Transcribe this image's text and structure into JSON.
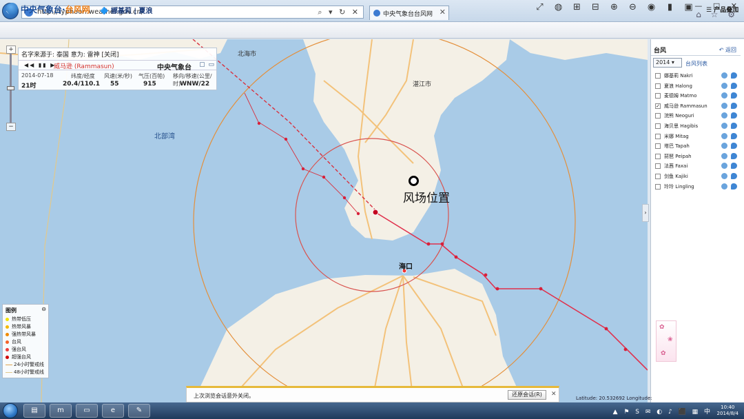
{
  "browser": {
    "url": "http://typhoon.weather.gov.cn/",
    "tab_title": "中央气象台台风网",
    "back_icon": "back-arrow-icon",
    "window_controls": [
      "—",
      "□",
      "✕"
    ],
    "toolbar_icons": [
      "home-icon",
      "star-icon",
      "gear-icon"
    ]
  },
  "app": {
    "site_title_main": "中央气象台·",
    "site_title_accent": "台风网",
    "active_typhoons": "娜基莉 | 夏浪",
    "product_overlay": "产品叠加",
    "tools": [
      "fullscreen-icon",
      "globe-icon",
      "zoom-box-in-icon",
      "zoom-box-out-icon",
      "zoom-in-icon",
      "zoom-out-icon",
      "layers-icon",
      "document-icon",
      "camera-icon"
    ]
  },
  "info_panel": {
    "source_line": "名字来源于: 泰国  意为: 雷神   [关闭]",
    "play_controls": "◀◀ ▮▮ ▶",
    "typhoon_name": "威马逊 (Rammasun)",
    "agency": "中央气象台",
    "headers": [
      "2014-07-18",
      "纬度/经度",
      "风速(米/秒)",
      "气压(百帕)",
      "移向/移速(公里/时)"
    ],
    "time_label": "21时",
    "values": [
      "20.4/110.1",
      "55",
      "915",
      "WNW/22"
    ]
  },
  "map": {
    "gulf_label": "北部湾",
    "haikou_label": "海口",
    "zhanjiang_label": "湛江市",
    "beihai_label": "北海市",
    "wind_field_label": "风场位置"
  },
  "legend": {
    "title": "图例",
    "close": "⊖",
    "items": [
      {
        "label": "热带低压",
        "color": "#f3e200"
      },
      {
        "label": "热带风暴",
        "color": "#f5b800"
      },
      {
        "label": "强热带风暴",
        "color": "#f08a00"
      },
      {
        "label": "台风",
        "color": "#f5632a"
      },
      {
        "label": "强台风",
        "color": "#ee3e3e"
      },
      {
        "label": "超强台风",
        "color": "#cf0000"
      }
    ],
    "lines": [
      {
        "label": "24小时警戒线",
        "color": "#e0a450"
      },
      {
        "label": "48小时警戒线",
        "color": "#e0c88a"
      }
    ]
  },
  "sidebar": {
    "title": "台风",
    "back": "返回",
    "year": "2014 ▾",
    "list_title": "台风列表",
    "typhoons": [
      {
        "name": "娜基莉 Nakri",
        "checked": false
      },
      {
        "name": "夏浪 Halong",
        "checked": false
      },
      {
        "name": "麦德姆 Matmo",
        "checked": false
      },
      {
        "name": "威马逊 Rammasun",
        "checked": true
      },
      {
        "name": "浣熊 Neoguri",
        "checked": false
      },
      {
        "name": "海贝思 Hagibis",
        "checked": false
      },
      {
        "name": "米娜 Mitag",
        "checked": false
      },
      {
        "name": "塔巴 Tapah",
        "checked": false
      },
      {
        "name": "琵琶 Peipah",
        "checked": false
      },
      {
        "name": "法茜 Faxai",
        "checked": false
      },
      {
        "name": "剑鱼 Kajiki",
        "checked": false
      },
      {
        "name": "玲玲 Lingling",
        "checked": false
      }
    ]
  },
  "notification": {
    "text": "上次浏览会话意外关闭。",
    "button": "还原会话(R)",
    "close": "✕"
  },
  "status": {
    "latitude": "Latitude: 20.532692   Longitude:"
  },
  "taskbar": {
    "apps": [
      "▤",
      "m",
      "▭",
      "e",
      "✎"
    ],
    "tray": "▲ ⚑ S ✉ ◐ ♪ ⬛ ▦ 中",
    "time": "10:40",
    "date": "2014/8/4"
  },
  "colors": {
    "track": "#e0304c",
    "wind_circle": "#e48f3a",
    "inner_circle": "#d9534f",
    "sea": "#a9cbe7",
    "land": "#f4f0e6"
  }
}
